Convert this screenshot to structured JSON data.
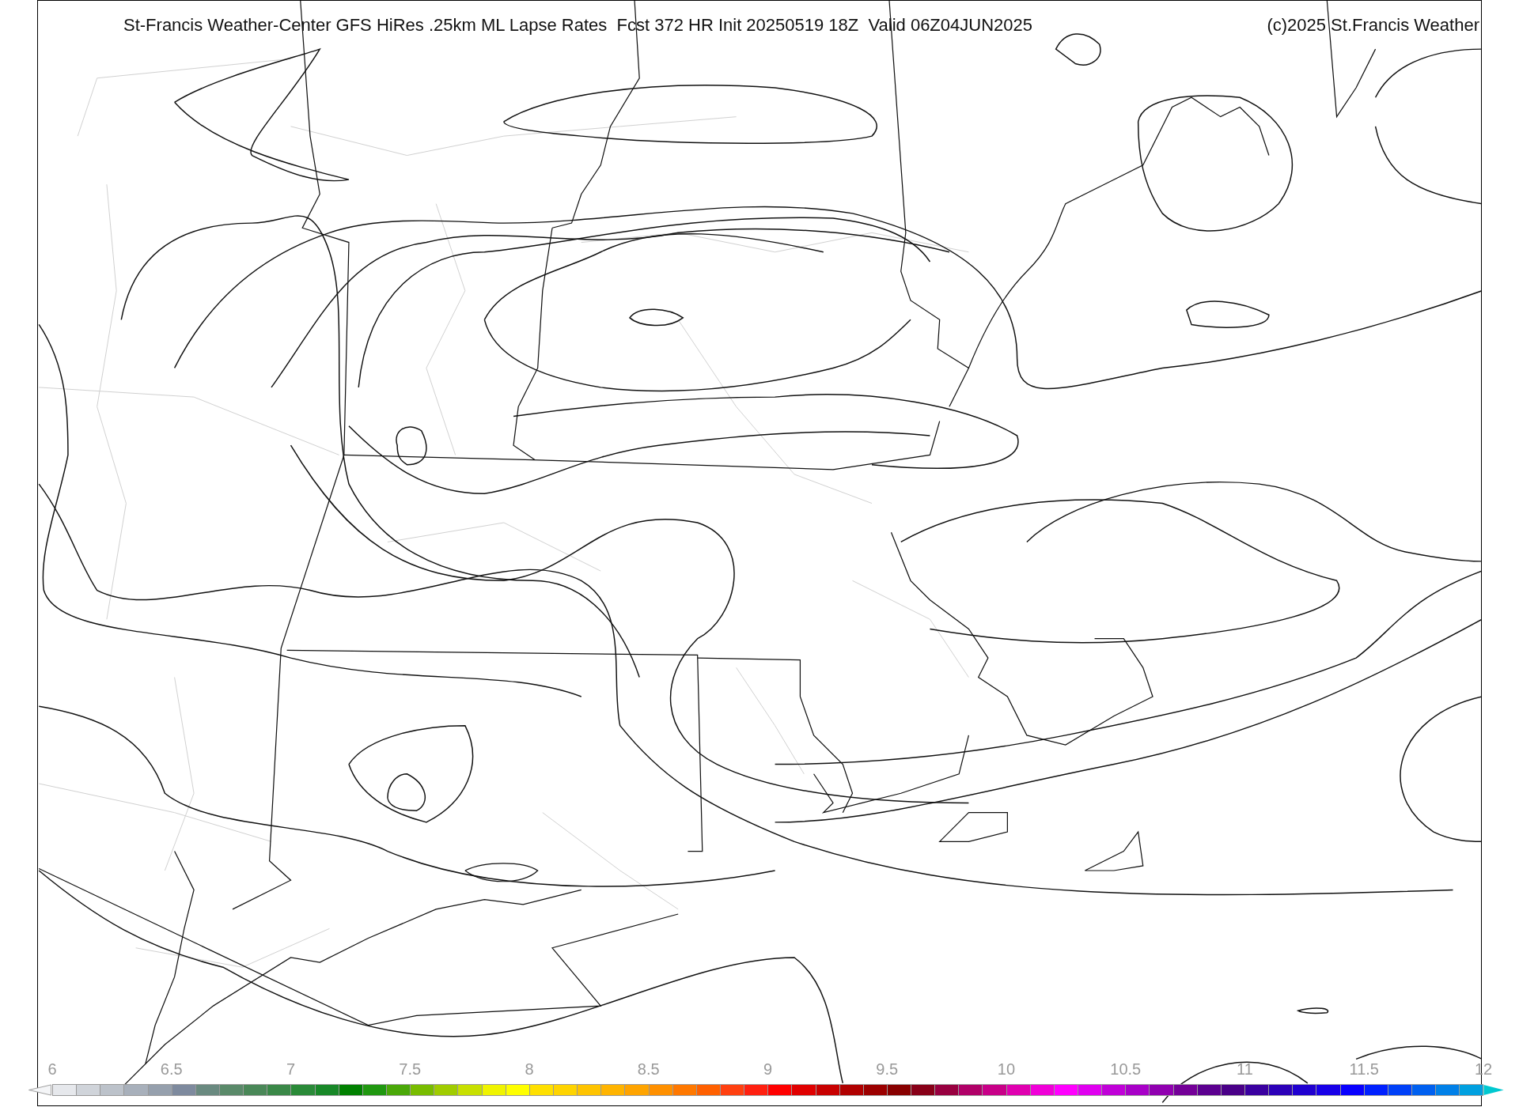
{
  "header": {
    "title": "St-Francis Weather-Center GFS HiRes .25km ML Lapse Rates  Fcst 372 HR Init 20250519 18Z  Valid 06Z04JUN2025",
    "copyright": "(c)2025 St.Francis Weather"
  },
  "colorbar": {
    "ticks": [
      "6",
      "6.5",
      "7",
      "7.5",
      "8",
      "8.5",
      "9",
      "9.5",
      "10",
      "10.5",
      "11",
      "11.5",
      "12"
    ],
    "swatches": [
      {
        "color": "#e6e8ec"
      },
      {
        "color": "#d0d4da"
      },
      {
        "color": "#bcc2ca"
      },
      {
        "color": "#a8b0bb"
      },
      {
        "color": "#96a0ad"
      },
      {
        "color": "#7e8a9e"
      },
      {
        "color": "#6a8a80"
      },
      {
        "color": "#5a8a6a"
      },
      {
        "color": "#4a8858"
      },
      {
        "color": "#3a8848"
      },
      {
        "color": "#2a8a38"
      },
      {
        "color": "#188828"
      },
      {
        "color": "#008000"
      },
      {
        "color": "#209810"
      },
      {
        "color": "#4aa808"
      },
      {
        "color": "#78bc00"
      },
      {
        "color": "#a0cc00"
      },
      {
        "color": "#c8e000"
      },
      {
        "color": "#f0f400"
      },
      {
        "color": "#ffff00"
      },
      {
        "color": "#ffe000"
      },
      {
        "color": "#ffd400"
      },
      {
        "color": "#ffc400"
      },
      {
        "color": "#ffb400"
      },
      {
        "color": "#ffa400"
      },
      {
        "color": "#ff9000"
      },
      {
        "color": "#ff7800"
      },
      {
        "color": "#ff6000"
      },
      {
        "color": "#ff4010"
      },
      {
        "color": "#ff2010"
      },
      {
        "color": "#ff0000"
      },
      {
        "color": "#e00000"
      },
      {
        "color": "#c80000"
      },
      {
        "color": "#b00000"
      },
      {
        "color": "#9c0000"
      },
      {
        "color": "#880000"
      },
      {
        "color": "#880018"
      },
      {
        "color": "#980040"
      },
      {
        "color": "#b00068"
      },
      {
        "color": "#c80088"
      },
      {
        "color": "#e000b0"
      },
      {
        "color": "#f000d8"
      },
      {
        "color": "#ff00ff"
      },
      {
        "color": "#e000f0"
      },
      {
        "color": "#c000d8"
      },
      {
        "color": "#a800c8"
      },
      {
        "color": "#9000b0"
      },
      {
        "color": "#740098"
      },
      {
        "color": "#5c0090"
      },
      {
        "color": "#4a0088"
      },
      {
        "color": "#3a00a0"
      },
      {
        "color": "#2c00b8"
      },
      {
        "color": "#2000d0"
      },
      {
        "color": "#1800e8"
      },
      {
        "color": "#0800ff"
      },
      {
        "color": "#0020ff"
      },
      {
        "color": "#0040f8"
      },
      {
        "color": "#0060f0"
      },
      {
        "color": "#0080e8"
      },
      {
        "color": "#00a0e0"
      }
    ],
    "max_arrow": {
      "color": "#00c8d0"
    }
  }
}
